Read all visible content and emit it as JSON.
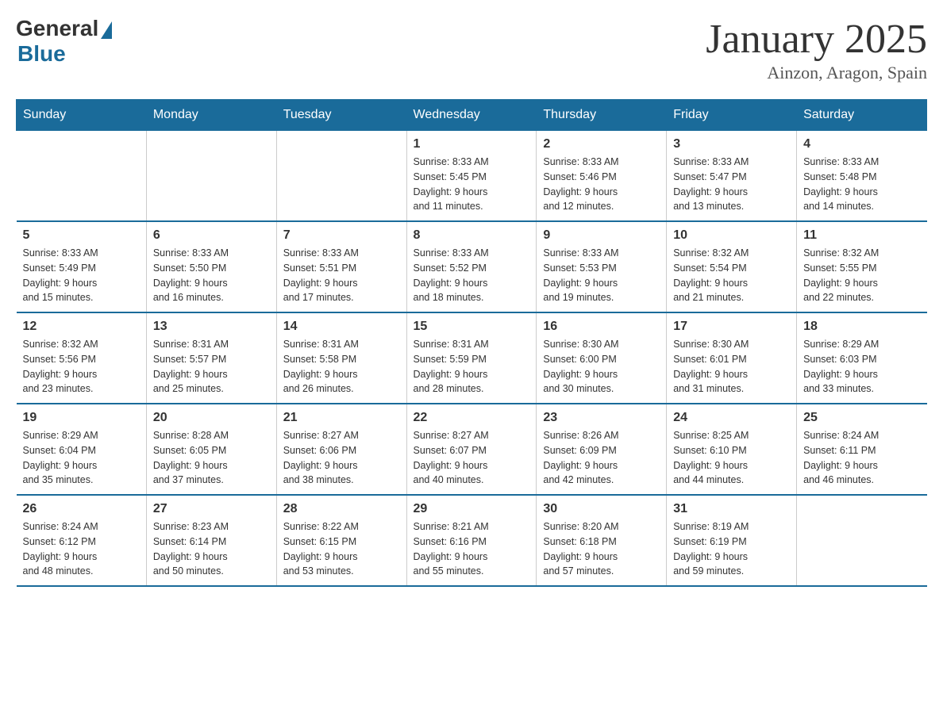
{
  "logo": {
    "general": "General",
    "blue": "Blue"
  },
  "title": "January 2025",
  "subtitle": "Ainzon, Aragon, Spain",
  "days_of_week": [
    "Sunday",
    "Monday",
    "Tuesday",
    "Wednesday",
    "Thursday",
    "Friday",
    "Saturday"
  ],
  "weeks": [
    [
      {
        "day": "",
        "info": ""
      },
      {
        "day": "",
        "info": ""
      },
      {
        "day": "",
        "info": ""
      },
      {
        "day": "1",
        "info": "Sunrise: 8:33 AM\nSunset: 5:45 PM\nDaylight: 9 hours\nand 11 minutes."
      },
      {
        "day": "2",
        "info": "Sunrise: 8:33 AM\nSunset: 5:46 PM\nDaylight: 9 hours\nand 12 minutes."
      },
      {
        "day": "3",
        "info": "Sunrise: 8:33 AM\nSunset: 5:47 PM\nDaylight: 9 hours\nand 13 minutes."
      },
      {
        "day": "4",
        "info": "Sunrise: 8:33 AM\nSunset: 5:48 PM\nDaylight: 9 hours\nand 14 minutes."
      }
    ],
    [
      {
        "day": "5",
        "info": "Sunrise: 8:33 AM\nSunset: 5:49 PM\nDaylight: 9 hours\nand 15 minutes."
      },
      {
        "day": "6",
        "info": "Sunrise: 8:33 AM\nSunset: 5:50 PM\nDaylight: 9 hours\nand 16 minutes."
      },
      {
        "day": "7",
        "info": "Sunrise: 8:33 AM\nSunset: 5:51 PM\nDaylight: 9 hours\nand 17 minutes."
      },
      {
        "day": "8",
        "info": "Sunrise: 8:33 AM\nSunset: 5:52 PM\nDaylight: 9 hours\nand 18 minutes."
      },
      {
        "day": "9",
        "info": "Sunrise: 8:33 AM\nSunset: 5:53 PM\nDaylight: 9 hours\nand 19 minutes."
      },
      {
        "day": "10",
        "info": "Sunrise: 8:32 AM\nSunset: 5:54 PM\nDaylight: 9 hours\nand 21 minutes."
      },
      {
        "day": "11",
        "info": "Sunrise: 8:32 AM\nSunset: 5:55 PM\nDaylight: 9 hours\nand 22 minutes."
      }
    ],
    [
      {
        "day": "12",
        "info": "Sunrise: 8:32 AM\nSunset: 5:56 PM\nDaylight: 9 hours\nand 23 minutes."
      },
      {
        "day": "13",
        "info": "Sunrise: 8:31 AM\nSunset: 5:57 PM\nDaylight: 9 hours\nand 25 minutes."
      },
      {
        "day": "14",
        "info": "Sunrise: 8:31 AM\nSunset: 5:58 PM\nDaylight: 9 hours\nand 26 minutes."
      },
      {
        "day": "15",
        "info": "Sunrise: 8:31 AM\nSunset: 5:59 PM\nDaylight: 9 hours\nand 28 minutes."
      },
      {
        "day": "16",
        "info": "Sunrise: 8:30 AM\nSunset: 6:00 PM\nDaylight: 9 hours\nand 30 minutes."
      },
      {
        "day": "17",
        "info": "Sunrise: 8:30 AM\nSunset: 6:01 PM\nDaylight: 9 hours\nand 31 minutes."
      },
      {
        "day": "18",
        "info": "Sunrise: 8:29 AM\nSunset: 6:03 PM\nDaylight: 9 hours\nand 33 minutes."
      }
    ],
    [
      {
        "day": "19",
        "info": "Sunrise: 8:29 AM\nSunset: 6:04 PM\nDaylight: 9 hours\nand 35 minutes."
      },
      {
        "day": "20",
        "info": "Sunrise: 8:28 AM\nSunset: 6:05 PM\nDaylight: 9 hours\nand 37 minutes."
      },
      {
        "day": "21",
        "info": "Sunrise: 8:27 AM\nSunset: 6:06 PM\nDaylight: 9 hours\nand 38 minutes."
      },
      {
        "day": "22",
        "info": "Sunrise: 8:27 AM\nSunset: 6:07 PM\nDaylight: 9 hours\nand 40 minutes."
      },
      {
        "day": "23",
        "info": "Sunrise: 8:26 AM\nSunset: 6:09 PM\nDaylight: 9 hours\nand 42 minutes."
      },
      {
        "day": "24",
        "info": "Sunrise: 8:25 AM\nSunset: 6:10 PM\nDaylight: 9 hours\nand 44 minutes."
      },
      {
        "day": "25",
        "info": "Sunrise: 8:24 AM\nSunset: 6:11 PM\nDaylight: 9 hours\nand 46 minutes."
      }
    ],
    [
      {
        "day": "26",
        "info": "Sunrise: 8:24 AM\nSunset: 6:12 PM\nDaylight: 9 hours\nand 48 minutes."
      },
      {
        "day": "27",
        "info": "Sunrise: 8:23 AM\nSunset: 6:14 PM\nDaylight: 9 hours\nand 50 minutes."
      },
      {
        "day": "28",
        "info": "Sunrise: 8:22 AM\nSunset: 6:15 PM\nDaylight: 9 hours\nand 53 minutes."
      },
      {
        "day": "29",
        "info": "Sunrise: 8:21 AM\nSunset: 6:16 PM\nDaylight: 9 hours\nand 55 minutes."
      },
      {
        "day": "30",
        "info": "Sunrise: 8:20 AM\nSunset: 6:18 PM\nDaylight: 9 hours\nand 57 minutes."
      },
      {
        "day": "31",
        "info": "Sunrise: 8:19 AM\nSunset: 6:19 PM\nDaylight: 9 hours\nand 59 minutes."
      },
      {
        "day": "",
        "info": ""
      }
    ]
  ]
}
